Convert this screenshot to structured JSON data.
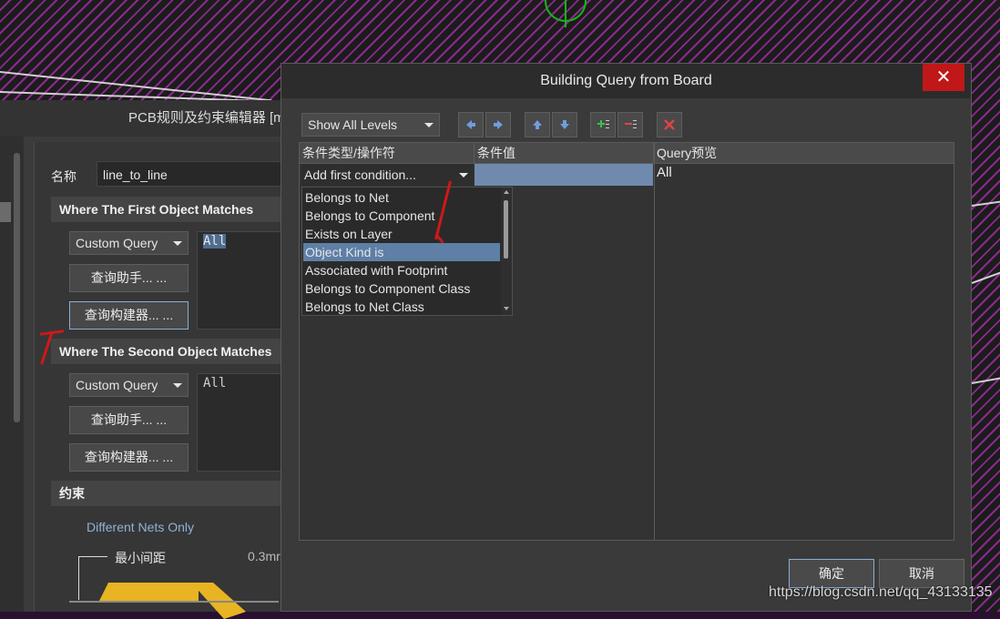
{
  "rule_editor": {
    "title": "PCB规则及约束编辑器 [m",
    "name_label": "名称",
    "name_value": "line_to_line",
    "first_section": {
      "header": "Where The First Object Matches",
      "query_mode": "Custom Query",
      "helper_button": "查询助手... ...",
      "builder_button": "查询构建器... ...",
      "query_text": "All"
    },
    "second_section": {
      "header": "Where The Second Object Matches",
      "query_mode": "Custom Query",
      "helper_button": "查询助手... ...",
      "builder_button": "查询构建器... ...",
      "query_text": "All"
    },
    "constraints": {
      "header": "约束",
      "net_scope": "Different Nets Only",
      "min_clearance_label": "最小间距",
      "min_clearance_value": "0.3mr"
    }
  },
  "dialog": {
    "title": "Building Query from Board",
    "close_glyph": "✕",
    "levels_select": "Show All Levels",
    "columns": {
      "condition_type": "条件类型/操作符",
      "condition_value": "条件值",
      "preview": "Query预览"
    },
    "condition_combo": "Add first condition...",
    "condition_options": [
      "Belongs to Net",
      "Belongs to Component",
      "Exists on Layer",
      "Object Kind is",
      "Associated with Footprint",
      "Belongs to Component Class",
      "Belongs to Net Class"
    ],
    "selected_option": "Object Kind is",
    "preview_text": "All",
    "ok_button": "确定",
    "cancel_button": "取消"
  },
  "watermark": "https://blog.csdn.net/qq_43133135",
  "colors": {
    "accent_selection": "#5e7fa6",
    "close_red": "#c01818",
    "annotation_red": "#d01818"
  }
}
